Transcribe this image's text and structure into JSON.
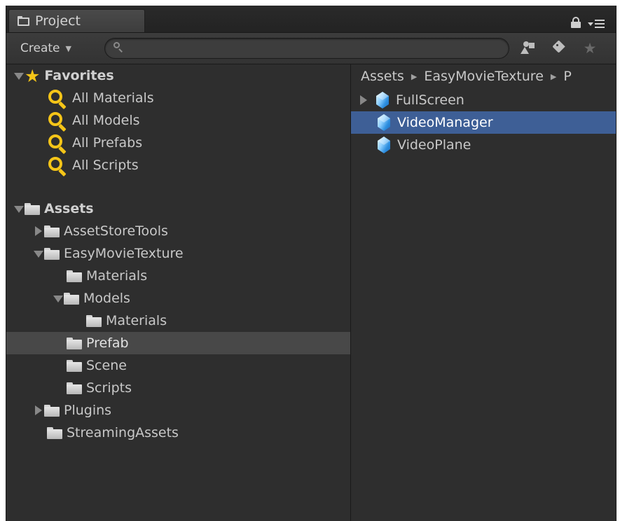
{
  "tab": {
    "title": "Project"
  },
  "toolbar": {
    "create_label": "Create",
    "search_value": "",
    "search_placeholder": ""
  },
  "favorites": {
    "label": "Favorites",
    "items": [
      "All Materials",
      "All Models",
      "All Prefabs",
      "All Scripts"
    ]
  },
  "assets_tree": {
    "label": "Assets",
    "items": [
      {
        "label": "AssetStoreTools",
        "state": "collapsed"
      },
      {
        "label": "EasyMovieTexture",
        "state": "expanded"
      },
      {
        "label": "Materials",
        "state": "leaf"
      },
      {
        "label": "Models",
        "state": "expanded"
      },
      {
        "label": "Materials",
        "state": "leaf"
      },
      {
        "label": "Prefab",
        "state": "leaf",
        "selected": true
      },
      {
        "label": "Scene",
        "state": "leaf"
      },
      {
        "label": "Scripts",
        "state": "leaf"
      },
      {
        "label": "Plugins",
        "state": "collapsed"
      },
      {
        "label": "StreamingAssets",
        "state": "leaf"
      }
    ]
  },
  "breadcrumb": [
    "Assets",
    "EasyMovieTexture",
    "P"
  ],
  "assets_list": [
    {
      "label": "FullScreen",
      "expandable": true
    },
    {
      "label": "VideoManager",
      "selected": true
    },
    {
      "label": "VideoPlane"
    }
  ],
  "colors": {
    "panel_bg": "#2e2e2e",
    "tree_selection": "#484848",
    "list_selection": "#3e5f96",
    "favorite_accent": "#f5c518"
  }
}
